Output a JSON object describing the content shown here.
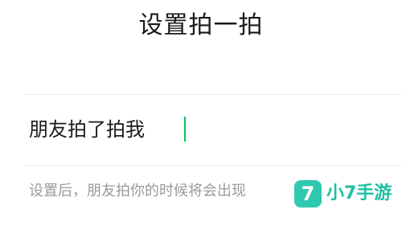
{
  "header": {
    "title": "设置拍一拍"
  },
  "pat_input": {
    "value": "朋友拍了拍我",
    "cursor_color": "#07c160"
  },
  "hint": {
    "text": "设置后，朋友拍你的时候将会出现"
  },
  "watermark": {
    "logo_glyph": "7",
    "text": "小7手游",
    "color": "#1fbfa3"
  },
  "colors": {
    "accent": "#07c160",
    "background": "#ffffff",
    "divider": "#ececec",
    "primary_text": "#1a1a1a",
    "secondary_text": "#9a9a9a"
  }
}
